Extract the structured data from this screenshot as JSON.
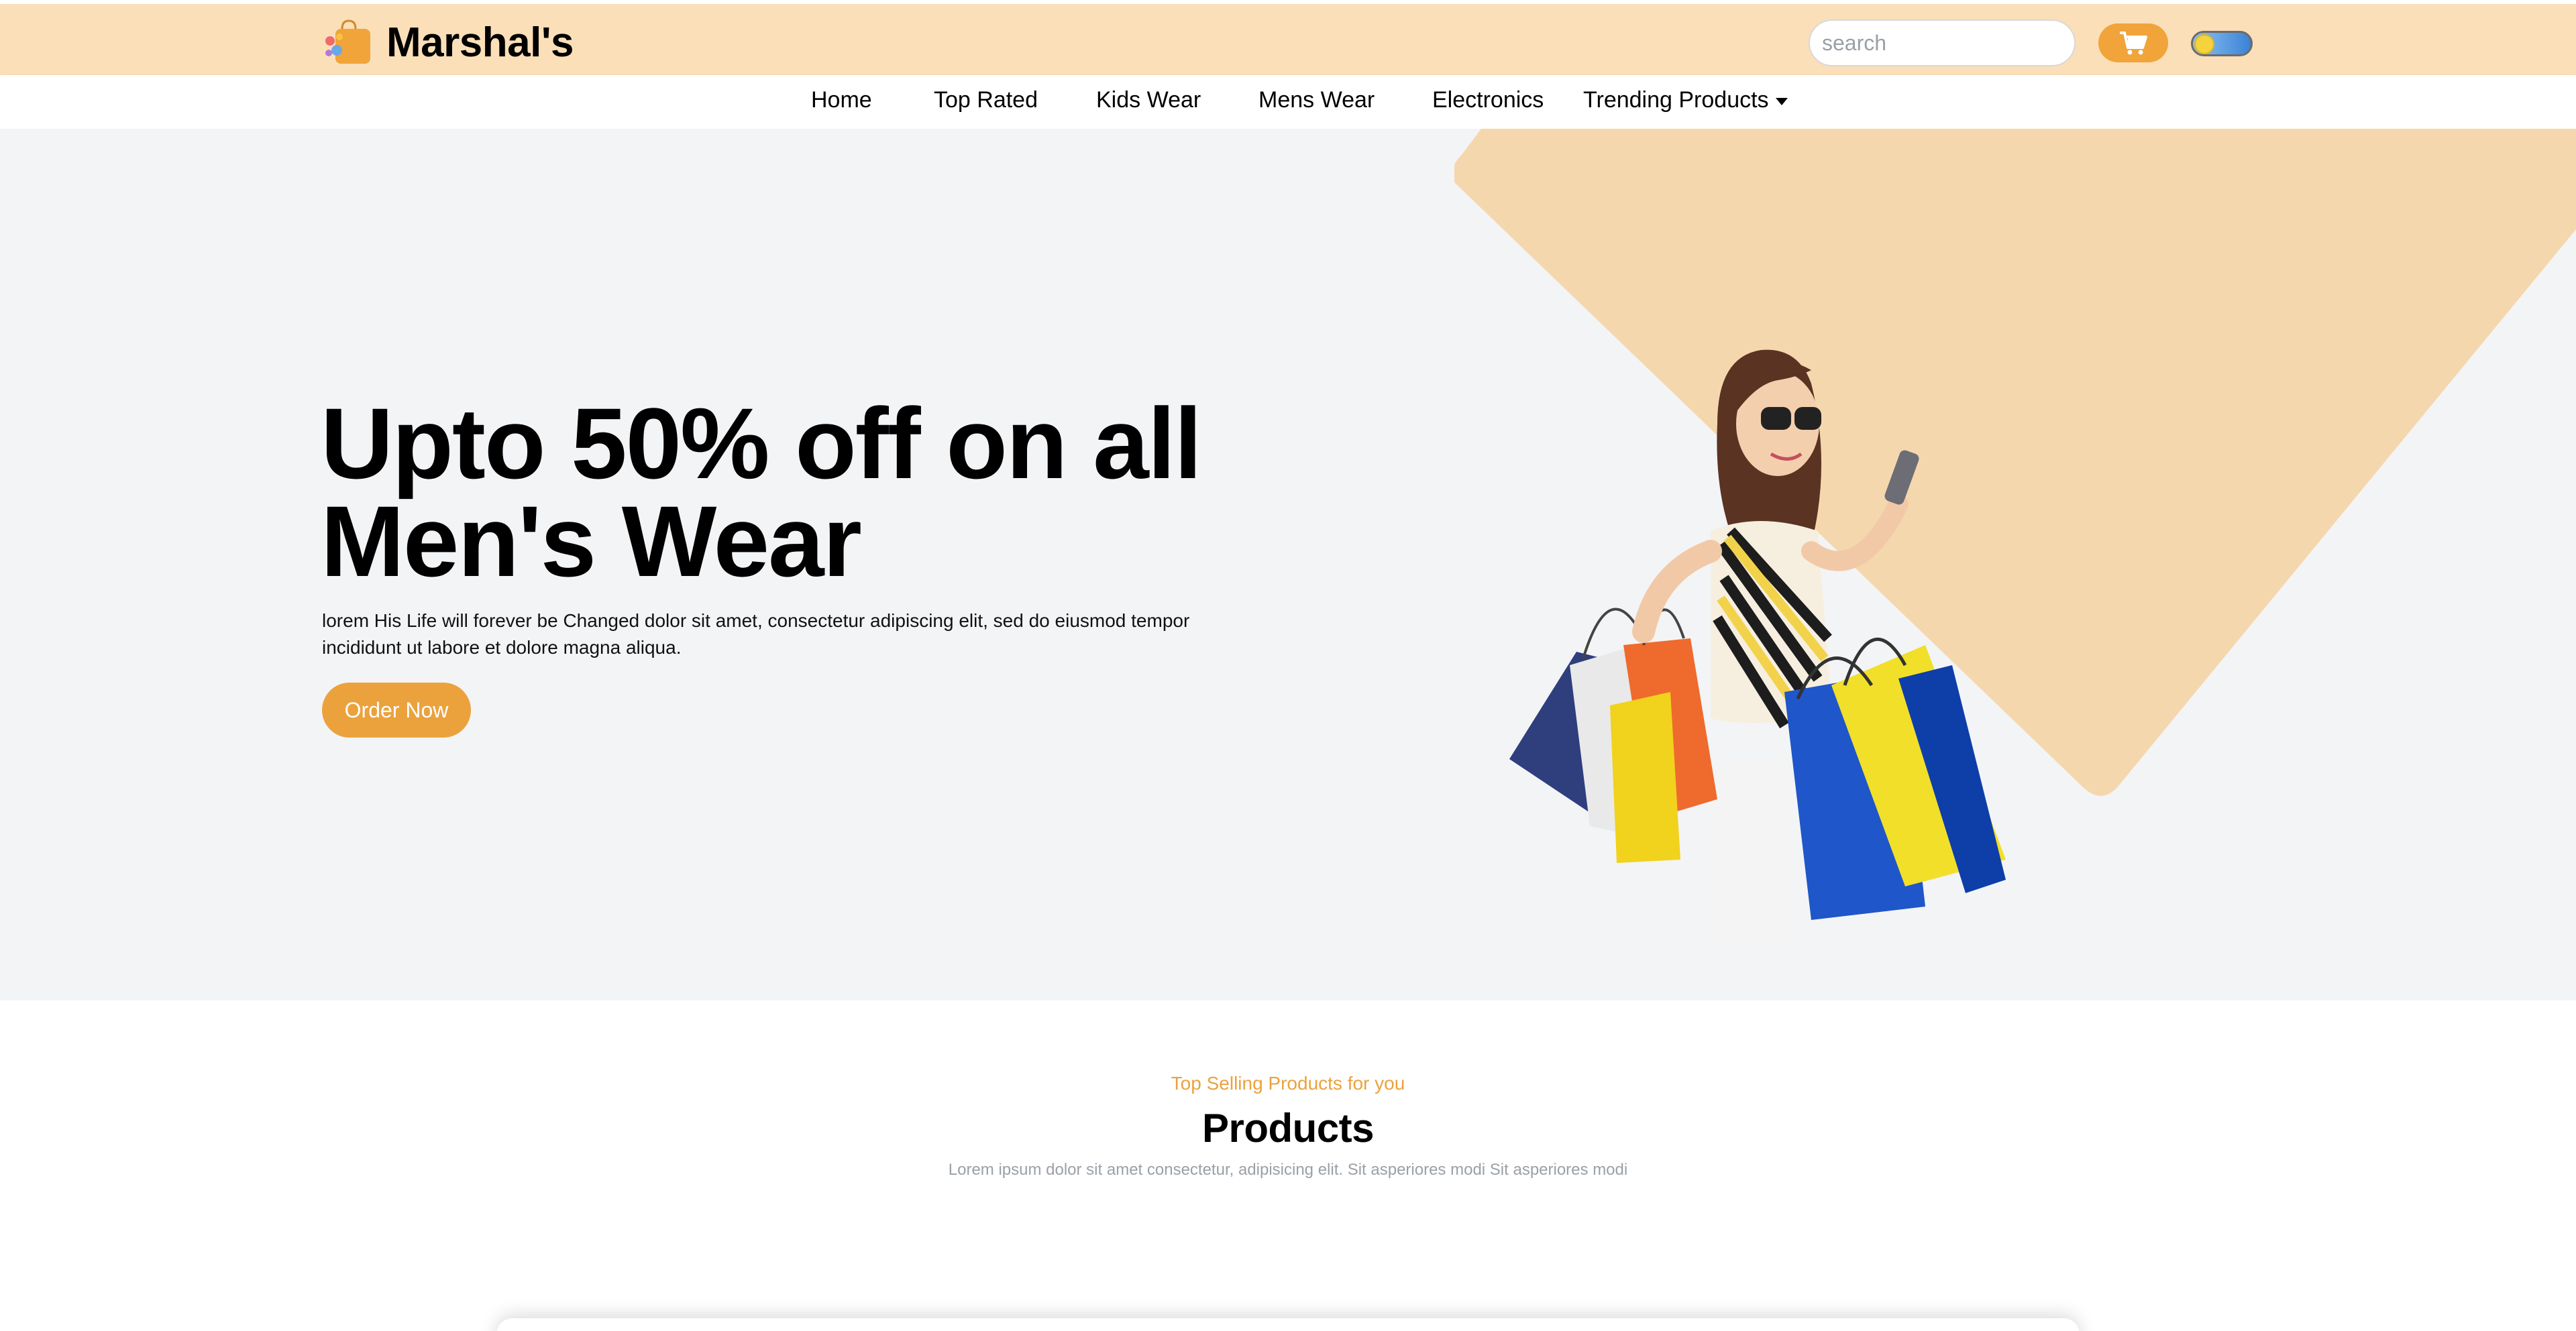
{
  "brand": {
    "name": "Marshal's"
  },
  "search": {
    "placeholder": "search"
  },
  "nav": {
    "items": [
      {
        "label": "Home"
      },
      {
        "label": "Top Rated"
      },
      {
        "label": "Kids Wear"
      },
      {
        "label": "Mens Wear"
      },
      {
        "label": "Electronics"
      },
      {
        "label": "Trending Products"
      }
    ]
  },
  "hero": {
    "title_line1": "Upto 50% off on all",
    "title_line2": "Men's Wear",
    "text": "lorem His Life will forever be Changed dolor sit amet, consectetur adipiscing elit, sed do eiusmod tempor incididunt ut labore et dolore magna aliqua.",
    "cta": "Order Now"
  },
  "products": {
    "eyebrow": "Top Selling Products for you",
    "title": "Products",
    "subtitle": "Lorem ipsum dolor sit amet consectetur, adipisicing elit. Sit asperiores modi Sit asperiores modi"
  },
  "colors": {
    "topbar": "#fbdfb8",
    "accent": "#eba23d",
    "hero_bg": "#f3f4f6",
    "hero_shape": "#f5d7ae"
  },
  "icons": [
    "shopping-bag-logo-icon",
    "search-icon",
    "cart-icon",
    "theme-toggle",
    "chevron-down-icon"
  ]
}
